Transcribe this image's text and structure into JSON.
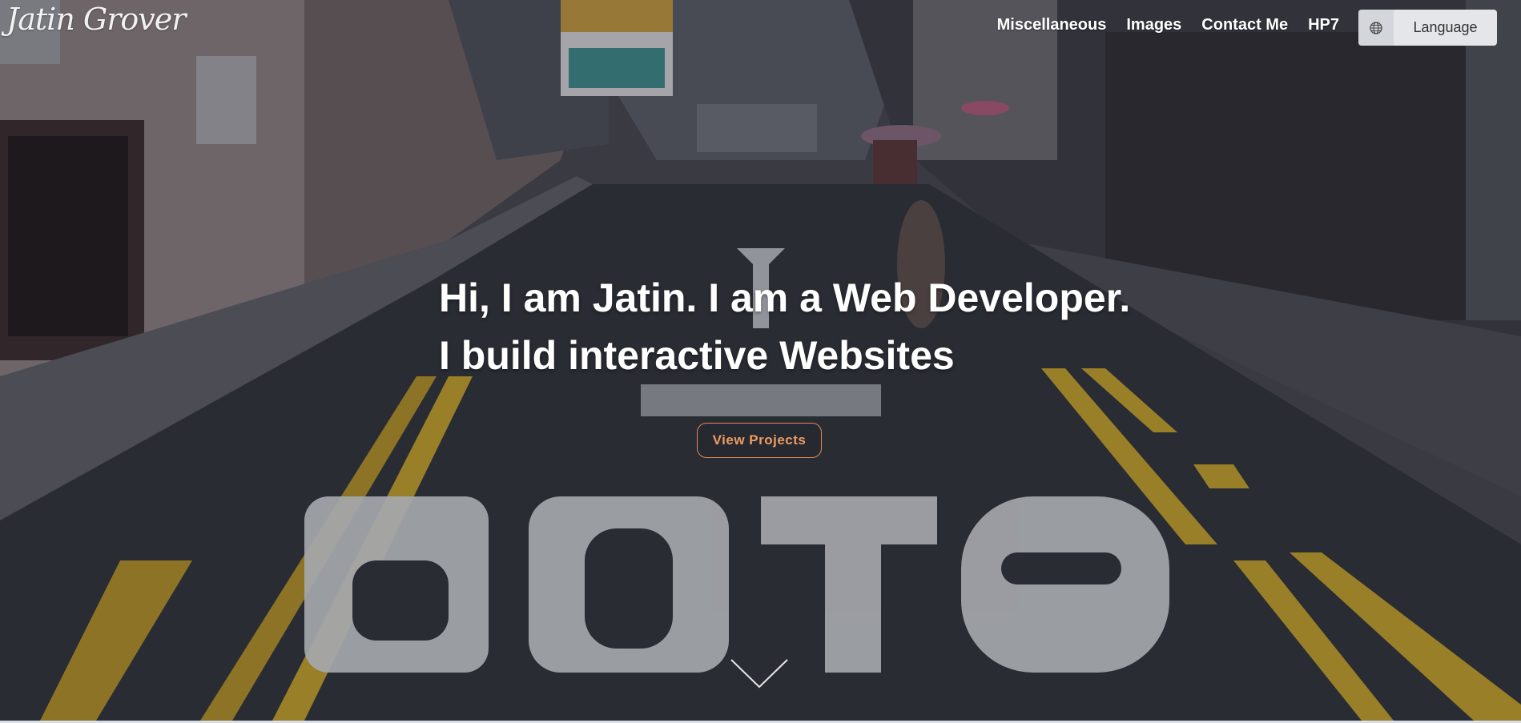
{
  "navbar": {
    "brand": "Jatin Grover",
    "links": [
      "Miscellaneous",
      "Images",
      "Contact Me",
      "HP7"
    ],
    "language_label": "Language",
    "language_icon": "globe-icon"
  },
  "hero": {
    "headline_line1": "Hi, I am Jatin. I am a Web Developer.",
    "headline_line2": "I build interactive Websites",
    "cta_label": "View Projects",
    "scroll_icon": "chevron-down-icon",
    "cta_color": "#ee9b64"
  }
}
